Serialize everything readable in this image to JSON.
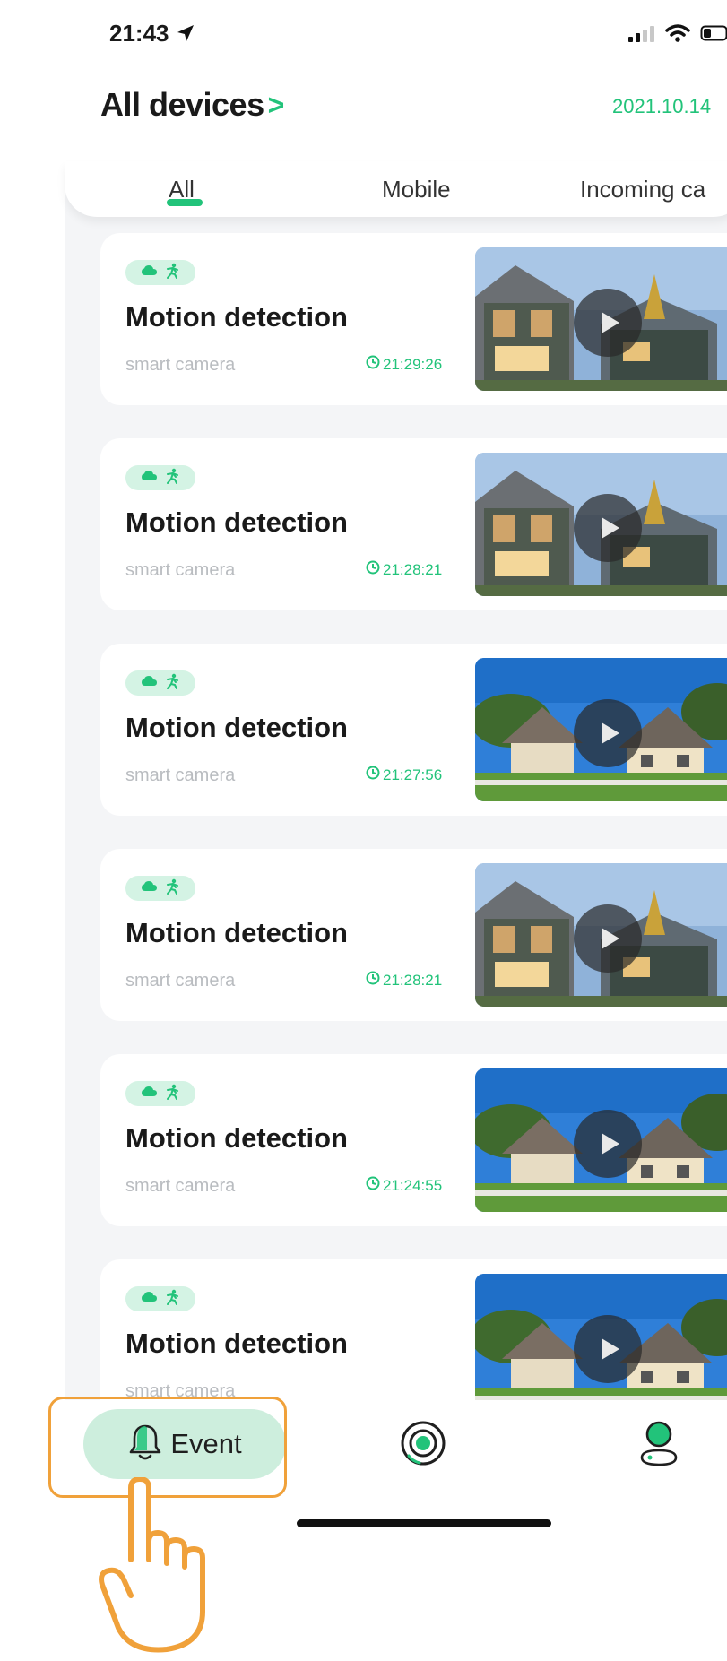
{
  "status_bar": {
    "time": "21:43"
  },
  "header": {
    "title": "All devices",
    "chevron": ">",
    "date": "2021.10.14"
  },
  "tabs": [
    {
      "label": "All",
      "active": true
    },
    {
      "label": "Mobile",
      "active": false
    },
    {
      "label": "Incoming ca",
      "active": false
    }
  ],
  "events": [
    {
      "title": "Motion detection",
      "device": "smart camera",
      "time": "21:29:26",
      "scene": "house-a"
    },
    {
      "title": "Motion detection",
      "device": "smart camera",
      "time": "21:28:21",
      "scene": "house-a"
    },
    {
      "title": "Motion detection",
      "device": "smart camera",
      "time": "21:27:56",
      "scene": "house-b"
    },
    {
      "title": "Motion detection",
      "device": "smart camera",
      "time": "21:28:21",
      "scene": "house-a"
    },
    {
      "title": "Motion detection",
      "device": "smart camera",
      "time": "21:24:55",
      "scene": "house-b"
    },
    {
      "title": "Motion detection",
      "device": "smart camera",
      "time": "",
      "scene": "house-b"
    }
  ],
  "bottom_nav": {
    "items": [
      {
        "label": "Event",
        "icon": "bell-icon",
        "active": true
      },
      {
        "label": "",
        "icon": "camera-icon",
        "active": false
      },
      {
        "label": "",
        "icon": "profile-icon",
        "active": false
      }
    ]
  },
  "colors": {
    "accent": "#22c37a",
    "pill": "#cdeedd",
    "highlight": "#f0a13a"
  }
}
